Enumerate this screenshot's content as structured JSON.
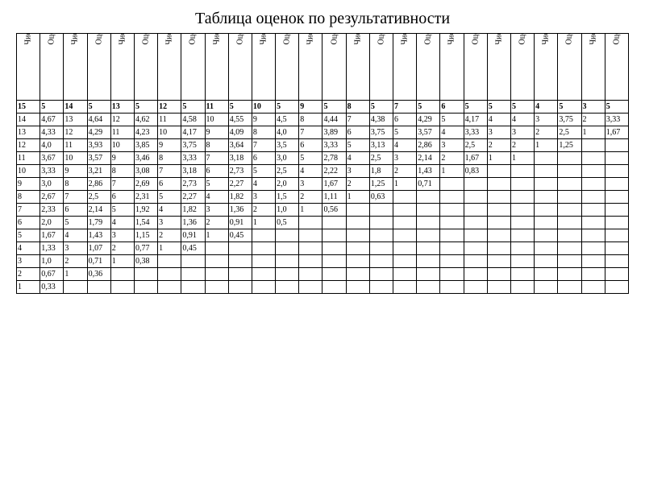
{
  "title": "Таблица оценок по результативности",
  "colHeaders": [
    "Число",
    "Оценка",
    "Число",
    "Оценка",
    "Число",
    "Оценка",
    "Число",
    "Оценка",
    "Число",
    "Оценка",
    "Число",
    "Оценка",
    "Число баллов",
    "Оценка",
    "Число",
    "Оценка",
    "Число баллов",
    "Оценка",
    "Число",
    "Оценка",
    "Число",
    "Оценка",
    "Число баллов",
    "Оценка",
    "Число баллов",
    "Оценка"
  ],
  "rows": [
    [
      "15",
      "5",
      "14",
      "5",
      "13",
      "5",
      "12",
      "5",
      "11",
      "5",
      "10",
      "5",
      "9",
      "5",
      "8",
      "5",
      "7",
      "5",
      "6",
      "5",
      "5",
      "5",
      "4",
      "5",
      "3",
      "5"
    ],
    [
      "14",
      "4,67",
      "13",
      "4,64",
      "12",
      "4,62",
      "11",
      "4,58",
      "10",
      "4,55",
      "9",
      "4,5",
      "8",
      "4,44",
      "7",
      "4,38",
      "6",
      "4,29",
      "5",
      "4,17",
      "4",
      "4",
      "3",
      "3,75",
      "2",
      "3,33"
    ],
    [
      "13",
      "4,33",
      "12",
      "4,29",
      "11",
      "4,23",
      "10",
      "4,17",
      "9",
      "4,09",
      "8",
      "4,0",
      "7",
      "3,89",
      "6",
      "3,75",
      "5",
      "3,57",
      "4",
      "3,33",
      "3",
      "3",
      "2",
      "2,5",
      "1",
      "1,67"
    ],
    [
      "12",
      "4,0",
      "11",
      "3,93",
      "10",
      "3,85",
      "9",
      "3,75",
      "8",
      "3,64",
      "7",
      "3,5",
      "6",
      "3,33",
      "5",
      "3,13",
      "4",
      "2,86",
      "3",
      "2,5",
      "2",
      "2",
      "1",
      "1,25",
      "",
      ""
    ],
    [
      "11",
      "3,67",
      "10",
      "3,57",
      "9",
      "3,46",
      "8",
      "3,33",
      "7",
      "3,18",
      "6",
      "3,0",
      "5",
      "2,78",
      "4",
      "2,5",
      "3",
      "2,14",
      "2",
      "1,67",
      "1",
      "1",
      "",
      "",
      "",
      ""
    ],
    [
      "10",
      "3,33",
      "9",
      "3,21",
      "8",
      "3,08",
      "7",
      "3,18",
      "6",
      "2,73",
      "5",
      "2,5",
      "4",
      "2,22",
      "3",
      "1,8",
      "2",
      "1,43",
      "1",
      "0,83",
      "",
      "",
      "",
      "",
      "",
      ""
    ],
    [
      "9",
      "3,0",
      "8",
      "2,86",
      "7",
      "2,69",
      "6",
      "2,73",
      "5",
      "2,27",
      "4",
      "2,0",
      "3",
      "1,67",
      "2",
      "1,25",
      "1",
      "0,71",
      "",
      "",
      "",
      "",
      "",
      "",
      "",
      ""
    ],
    [
      "8",
      "2,67",
      "7",
      "2,5",
      "6",
      "2,31",
      "5",
      "2,27",
      "4",
      "1,82",
      "3",
      "1,5",
      "2",
      "1,11",
      "1",
      "0,63",
      "",
      "",
      "",
      "",
      "",
      "",
      "",
      "",
      "",
      ""
    ],
    [
      "7",
      "2,33",
      "6",
      "2,14",
      "5",
      "1,92",
      "4",
      "1,82",
      "3",
      "1,36",
      "2",
      "1,0",
      "1",
      "0,56",
      "",
      "",
      "",
      "",
      "",
      "",
      "",
      "",
      "",
      "",
      "",
      ""
    ],
    [
      "6",
      "2,0",
      "5",
      "1,79",
      "4",
      "1,54",
      "3",
      "1,36",
      "2",
      "0,91",
      "1",
      "0,5",
      "",
      "",
      "",
      "",
      "",
      "",
      "",
      "",
      "",
      "",
      "",
      "",
      "",
      ""
    ],
    [
      "5",
      "1,67",
      "4",
      "1,43",
      "3",
      "1,15",
      "2",
      "0,91",
      "1",
      "0,45",
      "",
      "",
      "",
      "",
      "",
      "",
      "",
      "",
      "",
      "",
      "",
      "",
      "",
      "",
      "",
      ""
    ],
    [
      "4",
      "1,33",
      "3",
      "1,07",
      "2",
      "0,77",
      "1",
      "0,45",
      "",
      "",
      "",
      "",
      "",
      "",
      "",
      "",
      "",
      "",
      "",
      "",
      "",
      "",
      "",
      "",
      "",
      ""
    ],
    [
      "3",
      "1,0",
      "2",
      "0,71",
      "1",
      "0,38",
      "",
      "",
      "",
      "",
      "",
      "",
      "",
      "",
      "",
      "",
      "",
      "",
      "",
      "",
      "",
      "",
      "",
      "",
      "",
      ""
    ],
    [
      "2",
      "0,67",
      "1",
      "0,36",
      "",
      "",
      "",
      "",
      "",
      "",
      "",
      "",
      "",
      "",
      "",
      "",
      "",
      "",
      "",
      "",
      "",
      "",
      "",
      "",
      "",
      ""
    ],
    [
      "1",
      "0,33",
      "",
      "",
      "",
      "",
      "",
      "",
      "",
      "",
      "",
      "",
      "",
      "",
      "",
      "",
      "",
      "",
      "",
      "",
      "",
      "",
      "",
      "",
      "",
      ""
    ]
  ],
  "chart_data": {
    "type": "table",
    "title": "Таблица оценок по результативности",
    "columns": [
      "Число",
      "Оценка",
      "Число",
      "Оценка",
      "Число",
      "Оценка",
      "Число",
      "Оценка",
      "Число",
      "Оценка",
      "Число",
      "Оценка",
      "Число баллов",
      "Оценка",
      "Число",
      "Оценка",
      "Число баллов",
      "Оценка",
      "Число",
      "Оценка",
      "Число",
      "Оценка",
      "Число баллов",
      "Оценка",
      "Число баллов",
      "Оценка"
    ]
  }
}
